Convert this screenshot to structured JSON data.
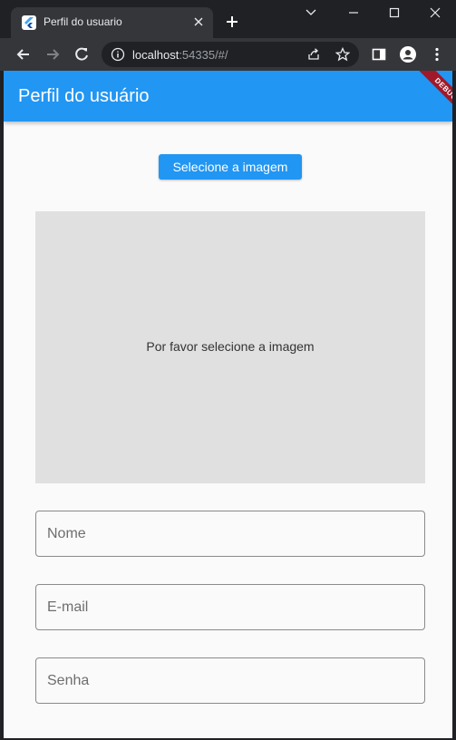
{
  "browser": {
    "tab_title": "Perfil do usuario",
    "url_host": "localhost",
    "url_rest": ":54335/#/"
  },
  "app": {
    "appbar_title": "Perfil do usuário",
    "debug_banner": "DEBUG",
    "select_image_button": "Selecione a imagem",
    "image_placeholder_text": "Por favor selecione a imagem",
    "fields": {
      "name_label": "Nome",
      "email_label": "E-mail",
      "password_label": "Senha"
    },
    "colors": {
      "primary": "#2196f3",
      "debug": "#a0192a"
    }
  }
}
